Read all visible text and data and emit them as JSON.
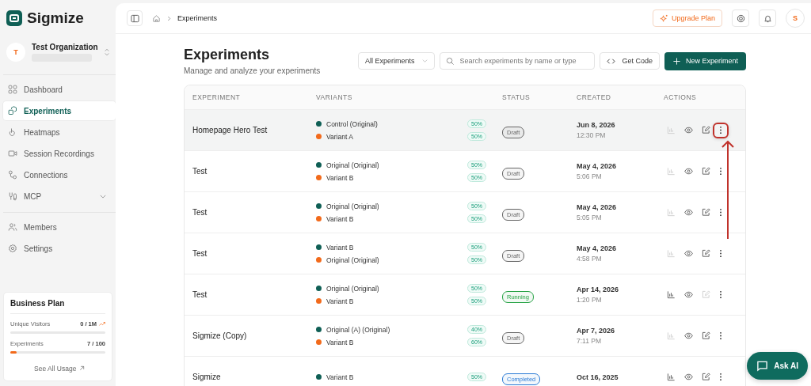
{
  "brand": {
    "name": "Sigmize"
  },
  "organization": {
    "avatar": "T",
    "name": "Test Organization"
  },
  "sidebar": {
    "items": [
      {
        "label": "Dashboard",
        "selected": false
      },
      {
        "label": "Experiments",
        "selected": true
      },
      {
        "label": "Heatmaps",
        "selected": false
      },
      {
        "label": "Session Recordings",
        "selected": false
      },
      {
        "label": "Connections",
        "selected": false
      },
      {
        "label": "MCP",
        "selected": false,
        "expanded": false
      }
    ],
    "footer_items": [
      {
        "label": "Members",
        "selected": false
      },
      {
        "label": "Settings",
        "selected": false
      }
    ]
  },
  "plan": {
    "title": "Business Plan",
    "meters": [
      {
        "label": "Unique Visitors",
        "reading": "0 / 1M",
        "trend": true,
        "level": 0
      },
      {
        "label": "Experiments",
        "reading": "7 / 100",
        "trend": false,
        "level": 0.07
      }
    ],
    "link": "See All Usage"
  },
  "topbar": {
    "breadcrumb": "Experiments",
    "upgrade": "Upgrade Plan",
    "avatar": "S"
  },
  "page": {
    "title": "Experiments",
    "subtitle": "Manage and analyze your experiments",
    "filter": "All Experiments",
    "search": {
      "placeholder": "Search experiments by name or type"
    },
    "get_code": "Get Code",
    "new_button": "New Experiment"
  },
  "table": {
    "columns": [
      "EXPERIMENT",
      "VARIANTS",
      "STATUS",
      "CREATED",
      "ACTIONS"
    ],
    "rows": [
      {
        "name": "Homepage Hero Test",
        "hovered": true,
        "variants": [
          {
            "name": "Control (Original)",
            "share": "50%",
            "color": "#0f5f55"
          },
          {
            "name": "Variant A",
            "share": "50%",
            "color": "#f26a1b"
          }
        ],
        "status": {
          "label": "Draft",
          "color": "#666666"
        },
        "date": "Jun 8, 2026",
        "time": "12:30 PM",
        "chart_enabled": false,
        "edit_enabled": true,
        "highlighted": true
      },
      {
        "name": "Test",
        "hovered": false,
        "variants": [
          {
            "name": "Original (Original)",
            "share": "50%",
            "color": "#0f5f55"
          },
          {
            "name": "Variant B",
            "share": "50%",
            "color": "#f26a1b"
          }
        ],
        "status": {
          "label": "Draft",
          "color": "#666666"
        },
        "date": "May 4, 2026",
        "time": "5:06 PM",
        "chart_enabled": false,
        "edit_enabled": true,
        "highlighted": false
      },
      {
        "name": "Test",
        "hovered": false,
        "variants": [
          {
            "name": "Original (Original)",
            "share": "50%",
            "color": "#0f5f55"
          },
          {
            "name": "Variant B",
            "share": "50%",
            "color": "#f26a1b"
          }
        ],
        "status": {
          "label": "Draft",
          "color": "#666666"
        },
        "date": "May 4, 2026",
        "time": "5:05 PM",
        "chart_enabled": false,
        "edit_enabled": true,
        "highlighted": false
      },
      {
        "name": "Test",
        "hovered": false,
        "variants": [
          {
            "name": "Variant B",
            "share": "50%",
            "color": "#0f5f55"
          },
          {
            "name": "Original (Original)",
            "share": "50%",
            "color": "#f26a1b"
          }
        ],
        "status": {
          "label": "Draft",
          "color": "#666666"
        },
        "date": "May 4, 2026",
        "time": "4:58 PM",
        "chart_enabled": false,
        "edit_enabled": true,
        "highlighted": false
      },
      {
        "name": "Test",
        "hovered": false,
        "variants": [
          {
            "name": "Original (Original)",
            "share": "50%",
            "color": "#0f5f55"
          },
          {
            "name": "Variant B",
            "share": "50%",
            "color": "#f26a1b"
          }
        ],
        "status": {
          "label": "Running",
          "color": "#25a244"
        },
        "date": "Apr 14, 2026",
        "time": "1:20 PM",
        "chart_enabled": true,
        "edit_enabled": false,
        "highlighted": false
      },
      {
        "name": "Sigmize (Copy)",
        "hovered": false,
        "variants": [
          {
            "name": "Original (A) (Original)",
            "share": "40%",
            "color": "#0f5f55"
          },
          {
            "name": "Variant B",
            "share": "60%",
            "color": "#f26a1b"
          }
        ],
        "status": {
          "label": "Draft",
          "color": "#666666"
        },
        "date": "Apr 7, 2026",
        "time": "7:11 PM",
        "chart_enabled": false,
        "edit_enabled": true,
        "highlighted": false
      },
      {
        "name": "Sigmize",
        "hovered": false,
        "variants": [
          {
            "name": "Variant B",
            "share": "50%",
            "color": "#0f5f55"
          }
        ],
        "status": {
          "label": "Completed",
          "color": "#2b7bd6"
        },
        "date": "Oct 16, 2025",
        "chart_enabled": true,
        "edit_enabled": true,
        "highlighted": false
      }
    ]
  },
  "ask_ai": "Ask AI"
}
